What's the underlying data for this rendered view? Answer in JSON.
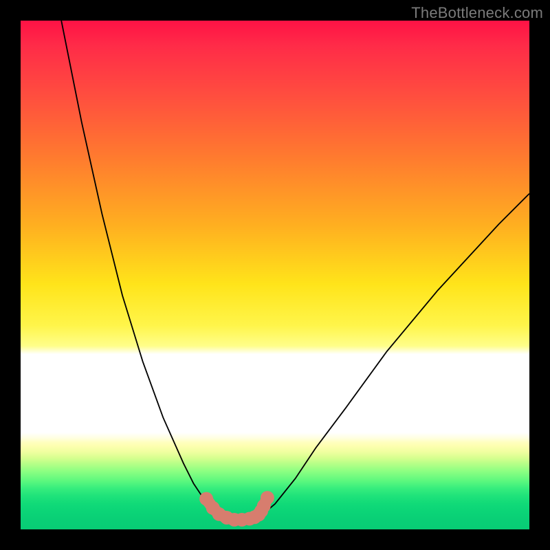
{
  "watermark": "TheBottleneck.com",
  "colors": {
    "black": "#000000",
    "curve": "#000000",
    "marker": "#d77d6e",
    "gradient_top": "#ff1245",
    "gradient_mid": "#ffe41a",
    "gradient_bottom": "#08cc75"
  },
  "chart_data": {
    "type": "line",
    "title": "",
    "xlabel": "",
    "ylabel": "",
    "xlim": [
      0,
      100
    ],
    "ylim": [
      0,
      100
    ],
    "series": [
      {
        "name": "left-branch",
        "x": [
          8,
          12,
          16,
          20,
          24,
          28,
          32,
          34,
          36,
          37.5,
          38.5
        ],
        "y": [
          100,
          80,
          62,
          46,
          33,
          22,
          13,
          9,
          6,
          4.2,
          3.4
        ]
      },
      {
        "name": "floor",
        "x": [
          38.5,
          40,
          42,
          44,
          46,
          47.5
        ],
        "y": [
          3.4,
          2.4,
          1.9,
          1.9,
          2.2,
          2.9
        ]
      },
      {
        "name": "right-branch",
        "x": [
          47.5,
          50,
          54,
          58,
          64,
          72,
          82,
          94,
          100
        ],
        "y": [
          2.9,
          5.0,
          10,
          16,
          24,
          35,
          47,
          60,
          66
        ]
      }
    ],
    "markers": {
      "name": "highlight-points",
      "x": [
        36.5,
        37.8,
        39.0,
        40.5,
        42.0,
        43.5,
        45.0,
        46.0,
        46.8,
        47.3,
        47.8,
        48.5
      ],
      "y": [
        6.0,
        4.2,
        3.0,
        2.3,
        1.9,
        1.9,
        2.1,
        2.4,
        2.9,
        3.6,
        4.6,
        6.2
      ]
    }
  }
}
